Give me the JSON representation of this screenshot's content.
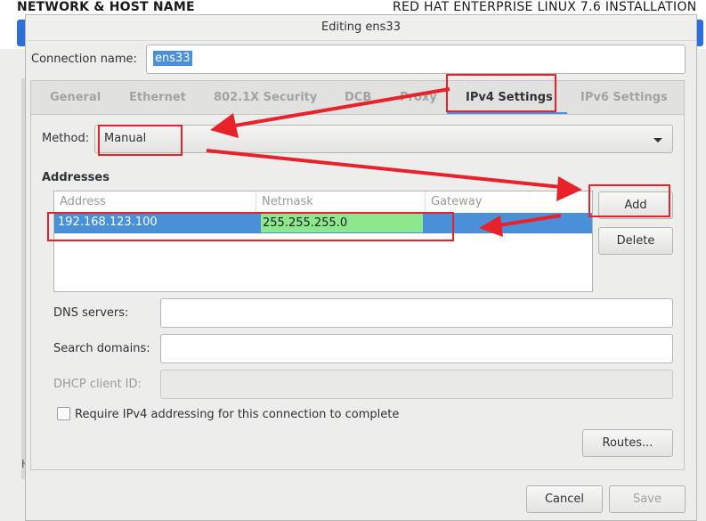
{
  "background": {
    "title_left": "NETWORK & HOST NAME",
    "title_right": "RED HAT ENTERPRISE LINUX 7.6 INSTALLATION",
    "frag_left": "H",
    "frag_right": "t"
  },
  "dialog": {
    "title": "Editing ens33",
    "connection_label": "Connection name:",
    "connection_value": "ens33"
  },
  "tabs": [
    {
      "label": "General"
    },
    {
      "label": "Ethernet"
    },
    {
      "label": "802.1X Security"
    },
    {
      "label": "DCB"
    },
    {
      "label": "Proxy"
    },
    {
      "label": "IPv4 Settings"
    },
    {
      "label": "IPv6 Settings"
    }
  ],
  "ipv4": {
    "method_label": "Method:",
    "method_value": "Manual",
    "addresses_heading": "Addresses",
    "columns": [
      "Address",
      "Netmask",
      "Gateway"
    ],
    "rows": [
      {
        "address": "192.168.123.100",
        "netmask": "255.255.255.0",
        "gateway": ""
      }
    ],
    "add_label": "Add",
    "delete_label": "Delete",
    "dns_label": "DNS servers:",
    "search_label": "Search domains:",
    "dhcp_label": "DHCP client ID:",
    "require_label": "Require IPv4 addressing for this connection to complete",
    "routes_label": "Routes..."
  },
  "footer": {
    "cancel_label": "Cancel",
    "save_label": "Save"
  },
  "colors": {
    "accent": "#4a90d9",
    "annotation": "#e8222a",
    "highlight": "#8de88d"
  }
}
